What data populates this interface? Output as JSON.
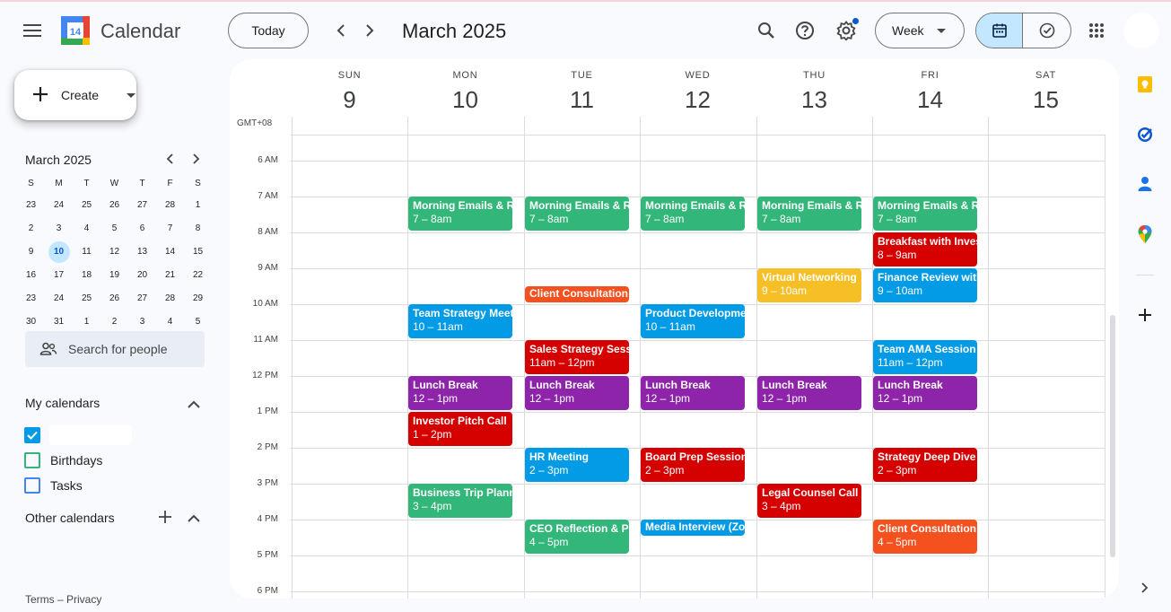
{
  "app": {
    "title": "Calendar",
    "logo_day": "14"
  },
  "header": {
    "today_label": "Today",
    "period_title": "March 2025",
    "view_label": "Week",
    "icons": [
      "menu-icon",
      "search-icon",
      "help-icon",
      "settings-icon",
      "calendar-view-icon",
      "tasks-view-icon",
      "apps-icon"
    ]
  },
  "sidebar": {
    "create_label": "Create",
    "mini_calendar": {
      "title": "March 2025",
      "weekdays": [
        "S",
        "M",
        "T",
        "W",
        "T",
        "F",
        "S"
      ],
      "weeks": [
        [
          "23",
          "24",
          "25",
          "26",
          "27",
          "28",
          "1"
        ],
        [
          "2",
          "3",
          "4",
          "5",
          "6",
          "7",
          "8"
        ],
        [
          "9",
          "10",
          "11",
          "12",
          "13",
          "14",
          "15"
        ],
        [
          "16",
          "17",
          "18",
          "19",
          "20",
          "21",
          "22"
        ],
        [
          "23",
          "24",
          "25",
          "26",
          "27",
          "28",
          "29"
        ],
        [
          "30",
          "31",
          "1",
          "2",
          "3",
          "4",
          "5"
        ]
      ],
      "selected": "10"
    },
    "search_people_placeholder": "Search for people",
    "my_calendars_title": "My calendars",
    "my_calendars": [
      {
        "name": "",
        "checked": true,
        "color": "#039be5"
      },
      {
        "name": "Birthdays",
        "checked": false,
        "color": "#33b679"
      },
      {
        "name": "Tasks",
        "checked": false,
        "color": "#4285f4"
      }
    ],
    "other_calendars_title": "Other calendars",
    "footer": "Terms – Privacy"
  },
  "week": {
    "timezone": "GMT+08",
    "days": [
      {
        "name": "SUN",
        "date": "9"
      },
      {
        "name": "MON",
        "date": "10"
      },
      {
        "name": "TUE",
        "date": "11"
      },
      {
        "name": "WED",
        "date": "12"
      },
      {
        "name": "THU",
        "date": "13"
      },
      {
        "name": "FRI",
        "date": "14"
      },
      {
        "name": "SAT",
        "date": "15"
      }
    ],
    "hours": [
      "6 AM",
      "7 AM",
      "8 AM",
      "9 AM",
      "10 AM",
      "11 AM",
      "12 PM",
      "1 PM",
      "2 PM",
      "3 PM",
      "4 PM",
      "5 PM",
      "6 PM"
    ],
    "events": [
      {
        "day": 1,
        "start": 7,
        "end": 8,
        "title": "Morning Emails & Review",
        "time": "7 – 8am",
        "color": "#33b679"
      },
      {
        "day": 2,
        "start": 7,
        "end": 8,
        "title": "Morning Emails & Review",
        "time": "7 – 8am",
        "color": "#33b679"
      },
      {
        "day": 3,
        "start": 7,
        "end": 8,
        "title": "Morning Emails & Review",
        "time": "7 – 8am",
        "color": "#33b679"
      },
      {
        "day": 4,
        "start": 7,
        "end": 8,
        "title": "Morning Emails & Review",
        "time": "7 – 8am",
        "color": "#33b679"
      },
      {
        "day": 5,
        "start": 7,
        "end": 8,
        "title": "Morning Emails & Review",
        "time": "7 – 8am",
        "color": "#33b679"
      },
      {
        "day": 5,
        "start": 8,
        "end": 9,
        "title": "Breakfast with Investors",
        "time": "8 – 9am",
        "color": "#d50000"
      },
      {
        "day": 4,
        "start": 9,
        "end": 10,
        "title": "Virtual Networking",
        "time": "9 – 10am",
        "color": "#f6bf26"
      },
      {
        "day": 5,
        "start": 9,
        "end": 10,
        "title": "Finance Review with CFO",
        "time": "9 – 10am",
        "color": "#039be5"
      },
      {
        "day": 2,
        "start": 9.5,
        "end": 10,
        "title": "Client Consultation",
        "time": "",
        "color": "#f4511e"
      },
      {
        "day": 1,
        "start": 10,
        "end": 11,
        "title": "Team Strategy Meeting",
        "time": "10 – 11am",
        "color": "#039be5"
      },
      {
        "day": 3,
        "start": 10,
        "end": 11,
        "title": "Product Development",
        "time": "10 – 11am",
        "color": "#039be5"
      },
      {
        "day": 2,
        "start": 11,
        "end": 12,
        "title": "Sales Strategy Session",
        "time": "11am – 12pm",
        "color": "#d50000"
      },
      {
        "day": 5,
        "start": 11,
        "end": 12,
        "title": "Team AMA Session",
        "time": "11am – 12pm",
        "color": "#039be5"
      },
      {
        "day": 1,
        "start": 12,
        "end": 13,
        "title": "Lunch Break",
        "time": "12 – 1pm",
        "color": "#8e24aa"
      },
      {
        "day": 2,
        "start": 12,
        "end": 13,
        "title": "Lunch Break",
        "time": "12 – 1pm",
        "color": "#8e24aa"
      },
      {
        "day": 3,
        "start": 12,
        "end": 13,
        "title": "Lunch Break",
        "time": "12 – 1pm",
        "color": "#8e24aa"
      },
      {
        "day": 4,
        "start": 12,
        "end": 13,
        "title": "Lunch Break",
        "time": "12 – 1pm",
        "color": "#8e24aa"
      },
      {
        "day": 5,
        "start": 12,
        "end": 13,
        "title": "Lunch Break",
        "time": "12 – 1pm",
        "color": "#8e24aa"
      },
      {
        "day": 1,
        "start": 13,
        "end": 14,
        "title": "Investor Pitch Call",
        "time": "1 – 2pm",
        "color": "#d50000"
      },
      {
        "day": 2,
        "start": 14,
        "end": 15,
        "title": "HR Meeting",
        "time": "2 – 3pm",
        "color": "#039be5"
      },
      {
        "day": 3,
        "start": 14,
        "end": 15,
        "title": "Board Prep Session",
        "time": "2 – 3pm",
        "color": "#d50000"
      },
      {
        "day": 5,
        "start": 14,
        "end": 15,
        "title": "Strategy Deep Dive",
        "time": "2 – 3pm",
        "color": "#d50000"
      },
      {
        "day": 1,
        "start": 15,
        "end": 16,
        "title": "Business Trip Planning",
        "time": "3 – 4pm",
        "color": "#33b679"
      },
      {
        "day": 4,
        "start": 15,
        "end": 16,
        "title": "Legal Counsel Call",
        "time": "3 – 4pm",
        "color": "#d50000"
      },
      {
        "day": 2,
        "start": 16,
        "end": 17,
        "title": "CEO Reflection & Planning",
        "time": "4 – 5pm",
        "color": "#33b679"
      },
      {
        "day": 3,
        "start": 16,
        "end": 16.5,
        "title": "Media Interview (Zoom)",
        "time": "",
        "color": "#039be5"
      },
      {
        "day": 5,
        "start": 16,
        "end": 17,
        "title": "Client Consultation",
        "time": "4 – 5pm",
        "color": "#f4511e"
      }
    ]
  }
}
